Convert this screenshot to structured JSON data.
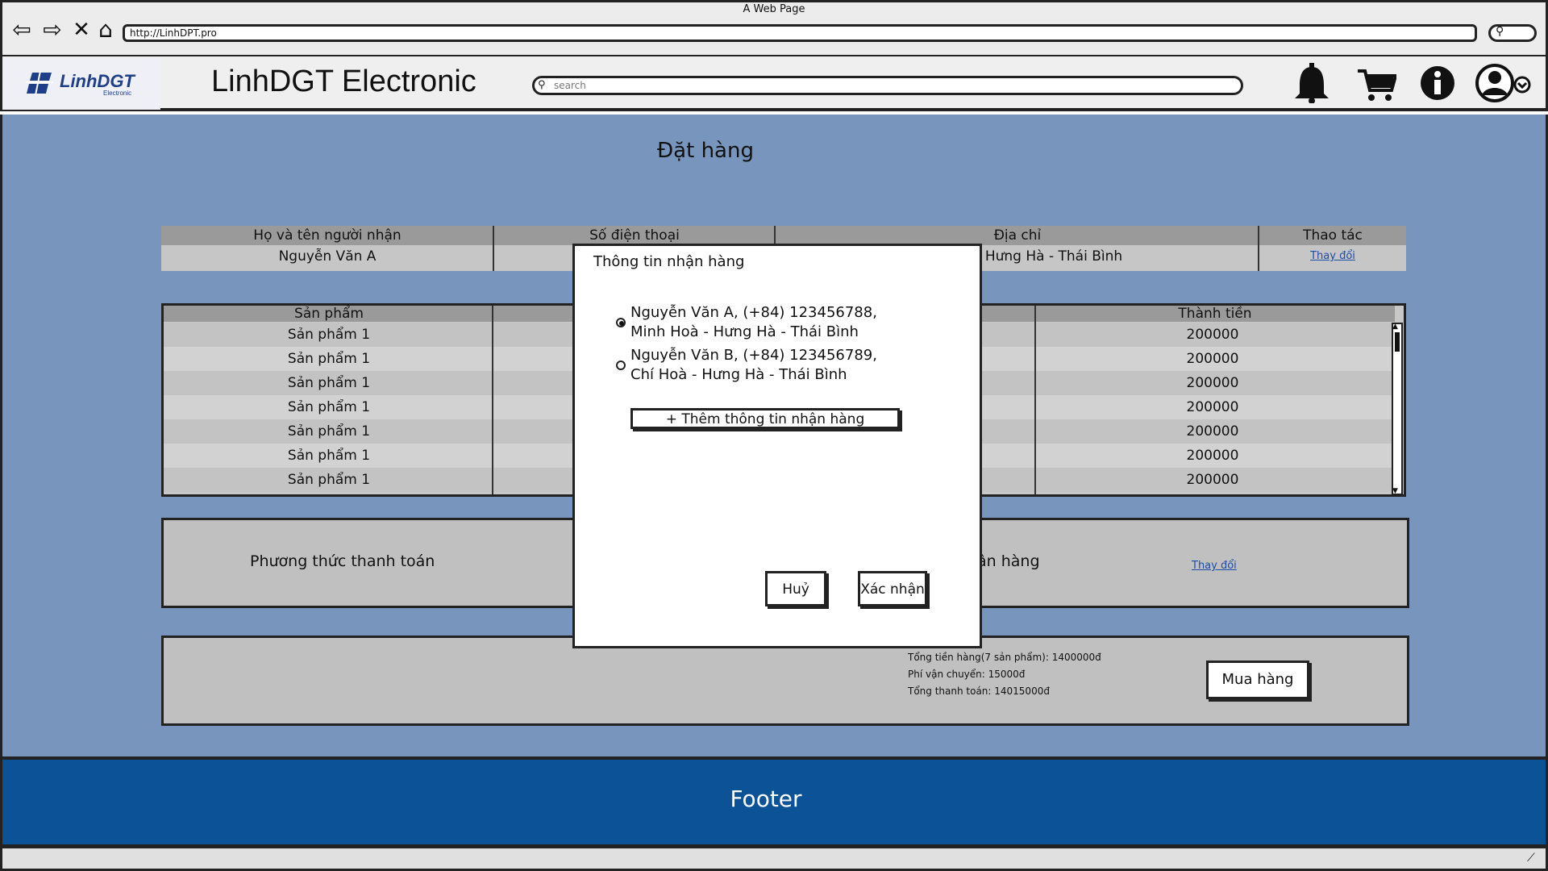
{
  "browser": {
    "window_title": "A Web Page",
    "url": "http://LinhDPT.pro"
  },
  "header": {
    "logo_text": "LinhDGT",
    "logo_sub": "Electronic",
    "site_title": "LinhDGT Electronic",
    "search_placeholder": "search"
  },
  "page": {
    "title": "Đặt hàng"
  },
  "recipient": {
    "headers": [
      "Họ và tên người nhận",
      "Số điện thoại",
      "Địa chỉ",
      "Thao tác"
    ],
    "name": "Nguyễn Văn A",
    "address_visible": "Hưng Hà - Thái Bình",
    "action_link": "Thay đổi"
  },
  "products": {
    "header_product": "Sản phẩm",
    "header_total": "Thành tiền",
    "rows": [
      {
        "name": "Sản phẩm 1",
        "total": "200000"
      },
      {
        "name": "Sản phẩm 1",
        "total": "200000"
      },
      {
        "name": "Sản phẩm 1",
        "total": "200000"
      },
      {
        "name": "Sản phẩm 1",
        "total": "200000"
      },
      {
        "name": "Sản phẩm 1",
        "total": "200000"
      },
      {
        "name": "Sản phẩm 1",
        "total": "200000"
      },
      {
        "name": "Sản phẩm 1",
        "total": "200000"
      }
    ]
  },
  "payment": {
    "label": "Phương thức thanh toán",
    "partial_label": "ận hàng",
    "change_link": "Thay đổi"
  },
  "summary": {
    "goods_total": "Tổng tiền hàng(7 sản phẩm): 1400000đ",
    "shipping": "Phí vận chuyển: 15000đ",
    "grand_total": "Tổng thanh toán: 14015000đ",
    "buy_button": "Mua hàng"
  },
  "modal": {
    "title": "Thông tin nhận hàng",
    "options": [
      {
        "line1": "Nguyễn Văn A, (+84) 123456788,",
        "line2": "Minh Hoà - Hưng Hà - Thái Bình",
        "selected": true
      },
      {
        "line1": "Nguyễn Văn B, (+84) 123456789,",
        "line2": "Chí Hoà - Hưng Hà - Thái Bình",
        "selected": false
      }
    ],
    "add_button": "+ Thêm thông tin nhận hàng",
    "cancel_button": "Huỷ",
    "confirm_button": "Xác nhận"
  },
  "footer": {
    "text": "Footer"
  }
}
